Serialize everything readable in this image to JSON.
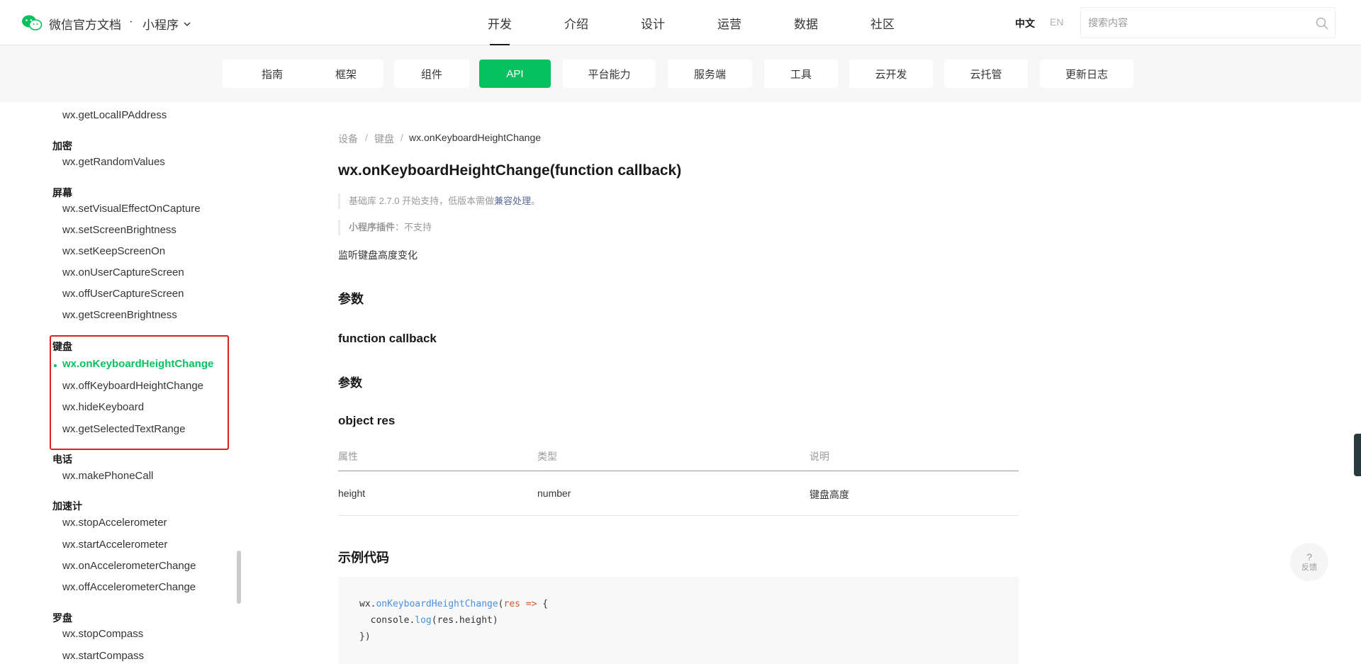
{
  "header": {
    "brand": "微信官方文档",
    "separator": "·",
    "product": "小程序",
    "nav": [
      "开发",
      "介绍",
      "设计",
      "运营",
      "数据",
      "社区"
    ],
    "lang_zh": "中文",
    "lang_en": "EN",
    "search_placeholder": "搜索内容"
  },
  "categories": [
    "指南",
    "框架",
    "组件",
    "API",
    "平台能力",
    "服务端",
    "工具",
    "云开发",
    "云托管",
    "更新日志"
  ],
  "sidebar": {
    "top_item": "wx.getLocalIPAddress",
    "groups": [
      {
        "title": "加密",
        "items": [
          "wx.getRandomValues"
        ]
      },
      {
        "title": "屏幕",
        "items": [
          "wx.setVisualEffectOnCapture",
          "wx.setScreenBrightness",
          "wx.setKeepScreenOn",
          "wx.onUserCaptureScreen",
          "wx.offUserCaptureScreen",
          "wx.getScreenBrightness"
        ]
      },
      {
        "title": "键盘",
        "items": [
          "wx.onKeyboardHeightChange",
          "wx.offKeyboardHeightChange",
          "wx.hideKeyboard",
          "wx.getSelectedTextRange"
        ]
      },
      {
        "title": "电话",
        "items": [
          "wx.makePhoneCall"
        ]
      },
      {
        "title": "加速计",
        "items": [
          "wx.stopAccelerometer",
          "wx.startAccelerometer",
          "wx.onAccelerometerChange",
          "wx.offAccelerometerChange"
        ]
      },
      {
        "title": "罗盘",
        "items": [
          "wx.stopCompass",
          "wx.startCompass"
        ]
      }
    ]
  },
  "content": {
    "breadcrumb": [
      "设备",
      "键盘",
      "wx.onKeyboardHeightChange"
    ],
    "breadcrumb_separator": "/",
    "title": "wx.onKeyboardHeightChange(function callback)",
    "support_prefix": "基础库 2.7.0 开始支持，低版本需做",
    "support_link": "兼容处理",
    "support_suffix": "。",
    "plugin_label": "小程序插件",
    "plugin_value": "：不支持",
    "description": "监听键盘高度变化",
    "params_heading": "参数",
    "callback_heading": "function callback",
    "params_heading_2": "参数",
    "object_heading": "object res",
    "table": {
      "headers": [
        "属性",
        "类型",
        "说明"
      ],
      "rows": [
        [
          "height",
          "number",
          "键盘高度"
        ]
      ]
    },
    "example_heading": "示例代码",
    "code": {
      "l1_obj": "wx.",
      "l1_fn": "onKeyboardHeightChange",
      "l1_open": "(",
      "l1_param": "res",
      "l1_arrow": " => ",
      "l1_brace": "{",
      "l2_pre": "  console.",
      "l2_fn": "log",
      "l2_post": "(res.height)",
      "l3": "})"
    }
  },
  "feedback": {
    "icon": "?",
    "label": "反馈"
  },
  "colors": {
    "accent": "#07c160",
    "highlight_border": "#e02020",
    "link": "#576b95"
  }
}
